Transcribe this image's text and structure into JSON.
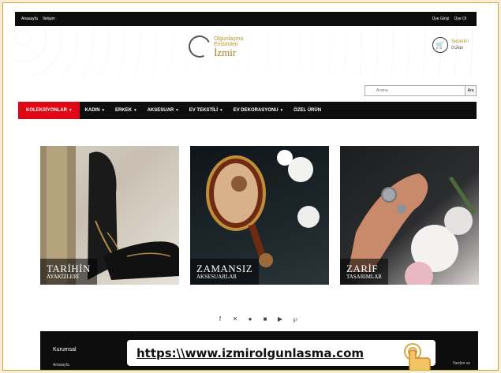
{
  "topbar": {
    "links": [
      "Anasayfa",
      "İletişim"
    ],
    "user_links": [
      "Üye Girişi",
      "Üye Ol"
    ]
  },
  "logo": {
    "line1": "Olgunlaşma",
    "line2": "Enstitüleri",
    "line3": "İzmir"
  },
  "cart": {
    "title": "Sepetim",
    "count": "0",
    "unit": "Ürün"
  },
  "search": {
    "placeholder": "Arama",
    "button": "Ara"
  },
  "nav": [
    {
      "label": "KOLEKSİYONLAR",
      "dropdown": true,
      "active": true
    },
    {
      "label": "KADIN",
      "dropdown": true
    },
    {
      "label": "ERKEK",
      "dropdown": true
    },
    {
      "label": "AKSESUAR",
      "dropdown": true
    },
    {
      "label": "EV TEKSTİLİ",
      "dropdown": true
    },
    {
      "label": "EV DEKORASYONU",
      "dropdown": true
    },
    {
      "label": "ÖZEL ÜRÜN",
      "dropdown": false
    }
  ],
  "tiles": [
    {
      "big": "TARİHİN",
      "small": "AYAKİZLERİ"
    },
    {
      "big": "ZAMANSIZ",
      "small": "AKSESUARLAR"
    },
    {
      "big": "ZARİF",
      "small": "TASARIMLAR"
    }
  ],
  "socials": [
    "facebook-icon",
    "x-icon",
    "pinterest-circle-icon",
    "linkedin-icon",
    "youtube-icon",
    "pinterest-icon"
  ],
  "footer": {
    "title": "Kurumsal",
    "sub": "Anasayfa",
    "right": "Yardım ve"
  },
  "overlay": {
    "url": "https:\\\\www.izmirolgunlasma.com"
  },
  "colors": {
    "accent_red": "#e10613",
    "gold": "#b8962e",
    "frame_border": "#c9a640"
  }
}
